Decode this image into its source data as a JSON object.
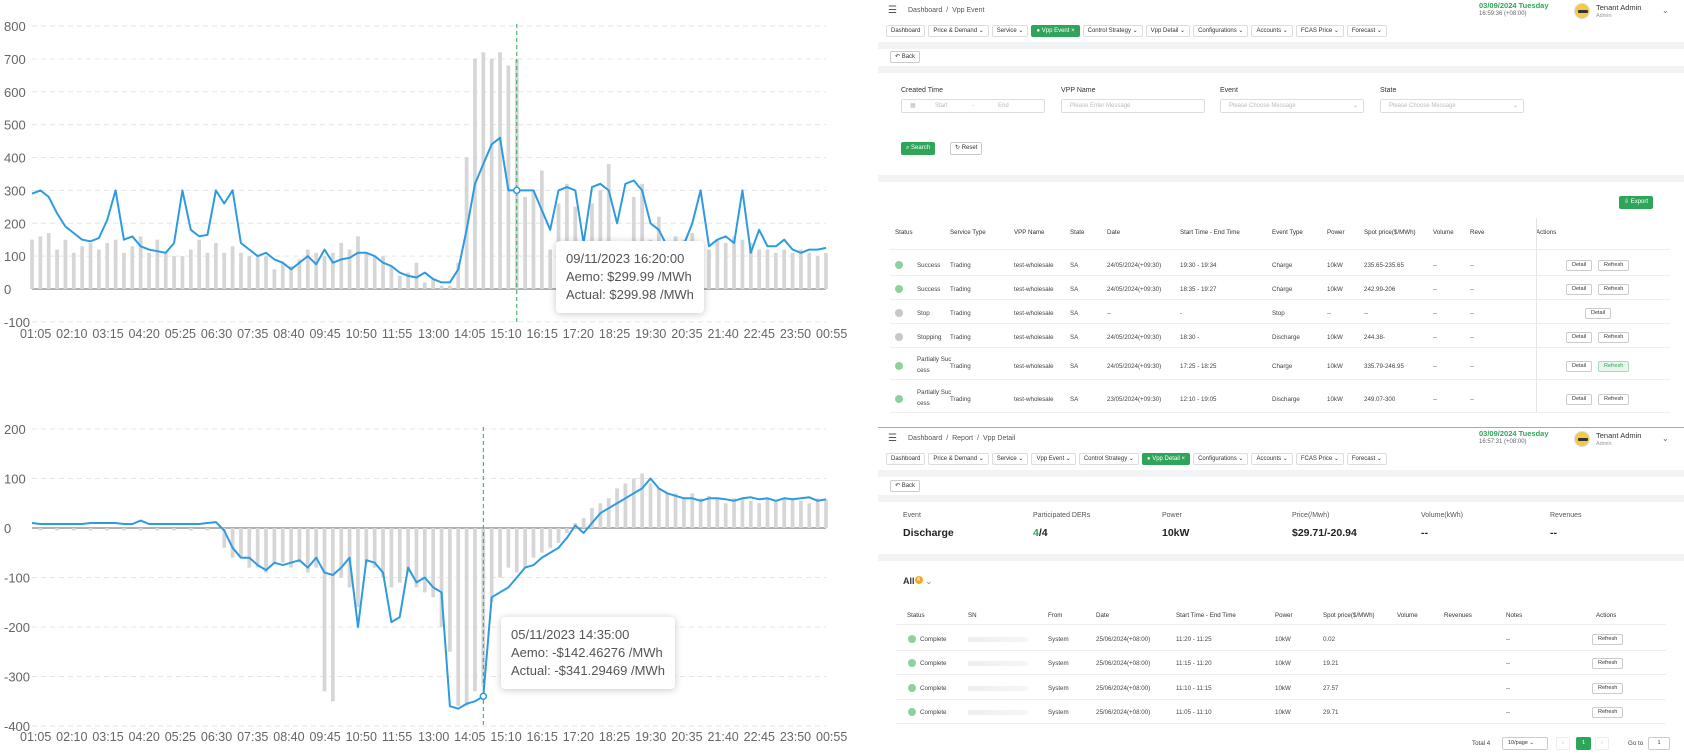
{
  "chart1": {
    "yticks": [
      "800",
      "700",
      "600",
      "500",
      "400",
      "300",
      "200",
      "100",
      "0",
      "-100"
    ],
    "xticks": [
      "01:05",
      "02:10",
      "03:15",
      "04:20",
      "05:25",
      "06:30",
      "07:35",
      "08:40",
      "09:45",
      "10:50",
      "11:55",
      "13:00",
      "14:05",
      "15:10",
      "16:15",
      "17:20",
      "18:25",
      "19:30",
      "20:35",
      "21:40",
      "22:45",
      "23:50",
      "00:55"
    ],
    "tooltip": {
      "date": "09/11/2023 16:20:00",
      "aemo": "Aemo: $299.99 /MWh",
      "actual": "Actual: $299.98 /MWh"
    }
  },
  "chart2": {
    "yticks": [
      "200",
      "100",
      "0",
      "-100",
      "-200",
      "-300",
      "-400"
    ],
    "xticks": [
      "01:05",
      "02:10",
      "03:15",
      "04:20",
      "05:25",
      "06:30",
      "07:35",
      "08:40",
      "09:45",
      "10:50",
      "11:55",
      "13:00",
      "14:05",
      "15:10",
      "16:15",
      "17:20",
      "18:25",
      "19:30",
      "20:35",
      "21:40",
      "22:45",
      "23:50",
      "00:55"
    ],
    "tooltip": {
      "date": "05/11/2023 14:35:00",
      "aemo": "Aemo: -$142.46276 /MWh",
      "actual": "Actual: -$341.29469 /MWh"
    }
  },
  "chart_data": [
    {
      "type": "line",
      "ylim": [
        -100,
        800
      ],
      "series": [
        {
          "values": [
            290,
            300,
            280,
            230,
            190,
            170,
            150,
            145,
            155,
            210,
            300,
            150,
            160,
            130,
            120,
            115,
            110,
            140,
            300,
            180,
            160,
            165,
            300,
            260,
            300,
            140,
            120,
            100,
            110,
            90,
            80,
            60,
            80,
            100,
            75,
            120,
            80,
            90,
            95,
            110,
            110,
            100,
            80,
            70,
            50,
            40,
            35,
            50,
            30,
            20,
            20,
            60,
            180,
            320,
            380,
            440,
            460,
            300,
            300,
            300,
            300,
            240,
            180,
            300,
            310,
            300,
            140,
            310,
            320,
            300,
            200,
            320,
            330,
            300,
            200,
            180,
            130,
            140,
            135,
            200,
            300,
            130,
            150,
            160,
            140,
            300,
            110,
            180,
            130,
            130,
            150,
            120,
            110,
            120,
            120,
            125
          ]
        },
        {
          "values": [
            150,
            160,
            170,
            120,
            150,
            110,
            130,
            140,
            120,
            140,
            150,
            110,
            130,
            160,
            110,
            150,
            110,
            100,
            100,
            120,
            150,
            110,
            140,
            110,
            130,
            110,
            100,
            100,
            100,
            60,
            80,
            70,
            90,
            120,
            110,
            100,
            110,
            140,
            120,
            160,
            110,
            100,
            100,
            70,
            40,
            50,
            80,
            20,
            30,
            10,
            10,
            80,
            400,
            700,
            720,
            700,
            720,
            680,
            700,
            280,
            300,
            360,
            120,
            260,
            320,
            250,
            120,
            260,
            300,
            380,
            120,
            140,
            280,
            320,
            150,
            220,
            120,
            160,
            150,
            170,
            140,
            120,
            150,
            140,
            160,
            150,
            140,
            120,
            120,
            110,
            120,
            110,
            120,
            110,
            100,
            110
          ]
        }
      ]
    },
    {
      "type": "line",
      "ylim": [
        -400,
        200
      ],
      "series": [
        {
          "values": [
            10,
            8,
            8,
            8,
            8,
            8,
            8,
            10,
            10,
            10,
            10,
            8,
            8,
            15,
            8,
            8,
            8,
            8,
            8,
            8,
            8,
            10,
            12,
            -5,
            -40,
            -60,
            -60,
            -75,
            -85,
            -70,
            -75,
            -70,
            -65,
            -80,
            -60,
            -90,
            -95,
            -80,
            -60,
            -200,
            -65,
            -70,
            -90,
            -190,
            -180,
            -80,
            -110,
            -100,
            -120,
            -130,
            -360,
            -365,
            -355,
            -350,
            -340,
            -140,
            -130,
            -120,
            -100,
            -80,
            -75,
            -60,
            -50,
            -40,
            -20,
            5,
            -10,
            10,
            30,
            40,
            50,
            60,
            70,
            80,
            100,
            80,
            70,
            65,
            60,
            60,
            55,
            60,
            60,
            58,
            55,
            60,
            62,
            58,
            60,
            55,
            60,
            58,
            60,
            62,
            55,
            58
          ]
        },
        {
          "values": [
            0,
            -5,
            0,
            -5,
            0,
            -5,
            0,
            -5,
            0,
            -5,
            0,
            -5,
            0,
            -5,
            0,
            -5,
            0,
            -5,
            0,
            -5,
            0,
            -5,
            0,
            -40,
            -60,
            -60,
            -80,
            -80,
            -90,
            -70,
            -70,
            -80,
            -70,
            -90,
            -80,
            -330,
            -350,
            -100,
            -120,
            -160,
            -70,
            -80,
            -100,
            -120,
            -110,
            -90,
            -120,
            -130,
            -140,
            -200,
            -250,
            -360,
            -360,
            -330,
            -320,
            -150,
            -100,
            -80,
            -90,
            -80,
            -60,
            -50,
            -40,
            -30,
            -10,
            10,
            20,
            40,
            50,
            60,
            80,
            90,
            100,
            110,
            90,
            80,
            70,
            70,
            60,
            70,
            60,
            65,
            60,
            50,
            60,
            58,
            55,
            50,
            60,
            55,
            58,
            60,
            55,
            50,
            60,
            58
          ]
        }
      ]
    }
  ],
  "panel1": {
    "crumbs": [
      "Dashboard",
      "/",
      "Vpp Event"
    ],
    "date": "03/09/2024  Tuesday",
    "time": "16:59:36  (+08:00)",
    "user": "Tenant Admin",
    "role": "Admin",
    "tabs": [
      "Dashboard",
      "Price & Demand ⌄",
      "Service ⌄",
      "● Vpp Event ×",
      "Control Strategy ⌄",
      "Vpp Detail ⌄",
      "Configurations ⌄",
      "Accounts ⌄",
      "FCAS Price ⌄",
      "Forecast ⌄"
    ],
    "back": "↶ Back",
    "filters": {
      "created_label": "Created Time",
      "start": "Start",
      "dash": "-",
      "end": "End",
      "vpp_label": "VPP Name",
      "vpp_ph": "Please Enter Message",
      "event_label": "Event",
      "event_ph": "Please Choose Message",
      "state_label": "State",
      "state_ph": "Please Choose Message"
    },
    "search": "⌕ Search",
    "reset": "↻ Reset",
    "export": "⇩ Export",
    "headers": [
      "Status",
      "Service Type",
      "VPP Name",
      "State",
      "Date",
      "Start Time - End Time",
      "Event Type",
      "Power",
      "Spot price($/MWh)",
      "Volume",
      "Reve",
      "Actions"
    ],
    "rows": [
      {
        "status": "Success",
        "service": "Trading",
        "vpp": "test-wholesale",
        "state": "SA",
        "date": "24/05/2024(+09:30)",
        "time": "19:30 - 19:34",
        "event": "Charge",
        "power": "10kW",
        "spot": "235.65-235.65",
        "volume": "--",
        "rev": "--",
        "a1": "Detail",
        "a2": "Refresh"
      },
      {
        "status": "Success",
        "service": "Trading",
        "vpp": "test-wholesale",
        "state": "SA",
        "date": "24/05/2024(+09:30)",
        "time": "18:35 - 19:27",
        "event": "Charge",
        "power": "10kW",
        "spot": "242.99-206",
        "volume": "--",
        "rev": "--",
        "a1": "Detail",
        "a2": "Refresh"
      },
      {
        "status": "Stop",
        "service": "Trading",
        "vpp": "test-wholesale",
        "state": "SA",
        "date": "--",
        "time": "-",
        "event": "Stop",
        "power": "--",
        "spot": "--",
        "volume": "--",
        "rev": "--",
        "a1": "Detail",
        "a2": ""
      },
      {
        "status": "Stopping",
        "service": "Trading",
        "vpp": "test-wholesale",
        "state": "SA",
        "date": "24/05/2024(+09:30)",
        "time": "18:30 -",
        "event": "Discharge",
        "power": "10kW",
        "spot": "244.38-",
        "volume": "--",
        "rev": "--",
        "a1": "Detail",
        "a2": "Refresh"
      },
      {
        "status": "Partially Suc cess",
        "service": "Trading",
        "vpp": "test-wholesale",
        "state": "SA",
        "date": "24/05/2024(+09:30)",
        "time": "17:25 - 18:25",
        "event": "Charge",
        "power": "10kW",
        "spot": "335.79-246.95",
        "volume": "--",
        "rev": "--",
        "a1": "Detail",
        "a2": "Refresh"
      },
      {
        "status": "Partially Suc cess",
        "service": "Trading",
        "vpp": "test-wholesale",
        "state": "SA",
        "date": "23/05/2024(+09:30)",
        "time": "12:10 - 19:05",
        "event": "Discharge",
        "power": "10kW",
        "spot": "249.07-300",
        "volume": "--",
        "rev": "--",
        "a1": "Detail",
        "a2": "Refresh"
      }
    ]
  },
  "panel2": {
    "crumbs": [
      "Dashboard",
      "/",
      "Report",
      "/",
      "Vpp Detail"
    ],
    "date": "03/09/2024  Tuesday",
    "time": "16:57:31  (+08:00)",
    "user": "Tenant Admin",
    "role": "Admin",
    "tabs": [
      "Dashboard",
      "Price & Demand ⌄",
      "Service ⌄",
      "Vpp Event ⌄",
      "Control Strategy ⌄",
      "● Vpp Detail ×",
      "Configurations ⌄",
      "Accounts ⌄",
      "FCAS Price ⌄",
      "Forecast ⌄"
    ],
    "back": "↶ Back",
    "summary": [
      {
        "label": "Event",
        "value": "Discharge"
      },
      {
        "label": "Participated DERs",
        "value_green": "4",
        "value": "/4"
      },
      {
        "label": "Power",
        "value": "10kW"
      },
      {
        "label": "Price(/Mwh)",
        "value": "$29.71/-20.94"
      },
      {
        "label": "Volume(kWh)",
        "value": "--"
      },
      {
        "label": "Revenues",
        "value": "--"
      }
    ],
    "all_label": "All",
    "all_badge": "4",
    "headers": [
      "Status",
      "SN",
      "From",
      "Date",
      "Start Time - End Time",
      "Power",
      "Spot price($/MWh)",
      "Volume",
      "Revenues",
      "Notes",
      "Actions"
    ],
    "rows": [
      {
        "status": "Complete",
        "from": "System",
        "date": "25/06/2024(+08:00)",
        "time": "11:20 - 11:25",
        "power": "10kW",
        "spot": "0.02",
        "notes": "--",
        "action": "Refresh"
      },
      {
        "status": "Complete",
        "from": "System",
        "date": "25/06/2024(+08:00)",
        "time": "11:15 - 11:20",
        "power": "10kW",
        "spot": "19.21",
        "notes": "--",
        "action": "Refresh"
      },
      {
        "status": "Complete",
        "from": "System",
        "date": "25/06/2024(+08:00)",
        "time": "11:10 - 11:15",
        "power": "10kW",
        "spot": "27.57",
        "notes": "--",
        "action": "Refresh"
      },
      {
        "status": "Complete",
        "from": "System",
        "date": "25/06/2024(+08:00)",
        "time": "11:05 - 11:10",
        "power": "10kW",
        "spot": "29.71",
        "notes": "--",
        "action": "Refresh"
      }
    ],
    "pagination": {
      "total": "Total 4",
      "per_page": "10/page ⌄",
      "prev": "‹",
      "page": "1",
      "next": "›",
      "goto": "Go to",
      "goto_val": "1"
    }
  },
  "colors": {
    "accent": "#2fa55b",
    "line": "#2e9be0",
    "bar": "#d6d6d6"
  }
}
